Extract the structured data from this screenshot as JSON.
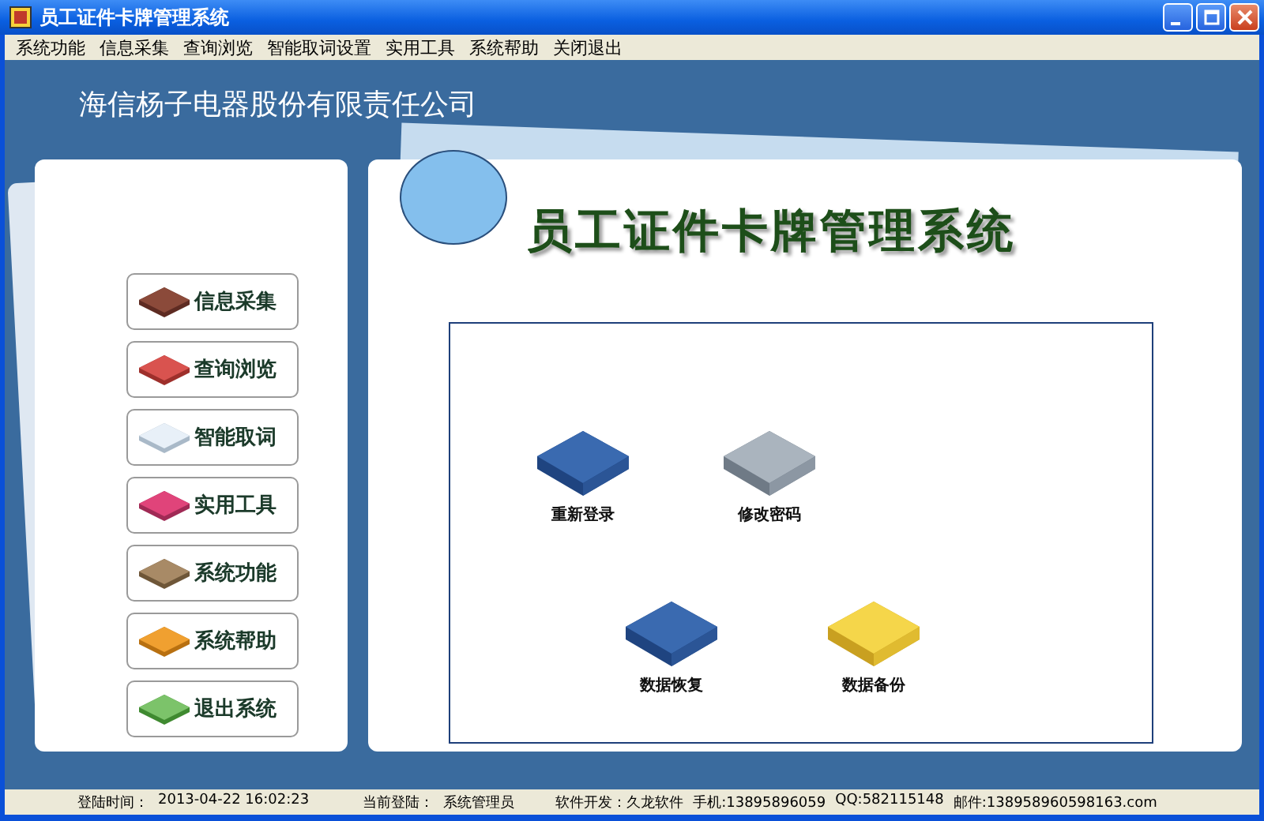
{
  "window": {
    "title": "员工证件卡牌管理系统"
  },
  "menu": [
    "系统功能",
    "信息采集",
    "查询浏览",
    "智能取词设置",
    "实用工具",
    "系统帮助",
    "关闭退出"
  ],
  "company": "海信杨子电器股份有限责任公司",
  "nav_buttons": [
    "信息采集",
    "查询浏览",
    "智能取词",
    "实用工具",
    "系统功能",
    "系统帮助",
    "退出系统"
  ],
  "banner_title": "员工证件卡牌管理系统",
  "shortcuts": [
    {
      "label": "重新登录"
    },
    {
      "label": "修改密码"
    },
    {
      "label": "数据恢复"
    },
    {
      "label": "数据备份"
    }
  ],
  "status_bar": [
    {
      "label": "登陆时间：",
      "value": "2013-04-22 16:02:23"
    },
    {
      "label": "当前登陆：",
      "value": "系统管理员"
    },
    {
      "label": "软件开发：久龙软件",
      "value": "手机:13895896059"
    },
    {
      "label": "QQ:582115148",
      "value": "邮件:138958960598163.com"
    }
  ]
}
